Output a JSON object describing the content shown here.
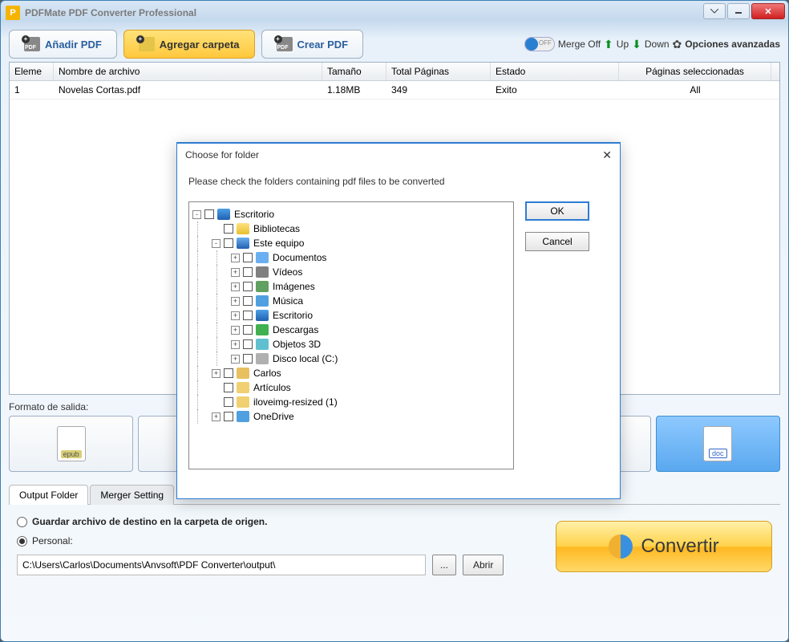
{
  "title": "PDFMate PDF Converter Professional",
  "toolbar": {
    "add_pdf": "Añadir PDF",
    "add_folder": "Agregar carpeta",
    "create_pdf": "Crear PDF",
    "merge": "Merge Off",
    "up": "Up",
    "down": "Down",
    "advanced": "Opciones avanzadas"
  },
  "grid": {
    "headers": {
      "idx": "Eleme",
      "name": "Nombre de archivo",
      "size": "Tamaño",
      "pages": "Total Páginas",
      "state": "Estado",
      "sel": "Páginas seleccionadas"
    },
    "rows": [
      {
        "idx": "1",
        "name": "Novelas Cortas.pdf",
        "size": "1.18MB",
        "pages": "349",
        "state": "Exito",
        "sel": "All"
      }
    ]
  },
  "formats_label": "Formato de salida:",
  "formats": {
    "epub": "epub",
    "doc": "doc"
  },
  "tabs": {
    "output": "Output Folder",
    "merger": "Merger Setting"
  },
  "output": {
    "opt_same": "Guardar archivo de destino en la carpeta de origen.",
    "opt_custom": "Personal:",
    "path": "C:\\Users\\Carlos\\Documents\\Anvsoft\\PDF Converter\\output\\",
    "browse": "...",
    "open": "Abrir"
  },
  "convert": "Convertir",
  "dialog": {
    "title": "Choose for folder",
    "instr": "Please check the folders containing  pdf files to be converted",
    "ok": "OK",
    "cancel": "Cancel",
    "tree": [
      {
        "level": 0,
        "exp": "-",
        "icon": "desktop",
        "label": "Escritorio"
      },
      {
        "level": 1,
        "exp": "",
        "icon": "yellow",
        "label": "Bibliotecas"
      },
      {
        "level": 1,
        "exp": "-",
        "icon": "pc",
        "label": "Este equipo"
      },
      {
        "level": 2,
        "exp": "+",
        "icon": "docs",
        "label": "Documentos"
      },
      {
        "level": 2,
        "exp": "+",
        "icon": "videos",
        "label": "Vídeos"
      },
      {
        "level": 2,
        "exp": "+",
        "icon": "img",
        "label": "Imágenes"
      },
      {
        "level": 2,
        "exp": "+",
        "icon": "music",
        "label": "Música"
      },
      {
        "level": 2,
        "exp": "+",
        "icon": "desktop",
        "label": "Escritorio"
      },
      {
        "level": 2,
        "exp": "+",
        "icon": "downloads",
        "label": "Descargas"
      },
      {
        "level": 2,
        "exp": "+",
        "icon": "obj3d",
        "label": "Objetos 3D"
      },
      {
        "level": 2,
        "exp": "+",
        "icon": "disk",
        "label": "Disco local (C:)"
      },
      {
        "level": 1,
        "exp": "+",
        "icon": "user",
        "label": "Carlos"
      },
      {
        "level": 1,
        "exp": "",
        "icon": "folder",
        "label": "Artículos"
      },
      {
        "level": 1,
        "exp": "",
        "icon": "folder",
        "label": "iloveimg-resized (1)"
      },
      {
        "level": 1,
        "exp": "+",
        "icon": "cloud",
        "label": "OneDrive"
      }
    ]
  }
}
